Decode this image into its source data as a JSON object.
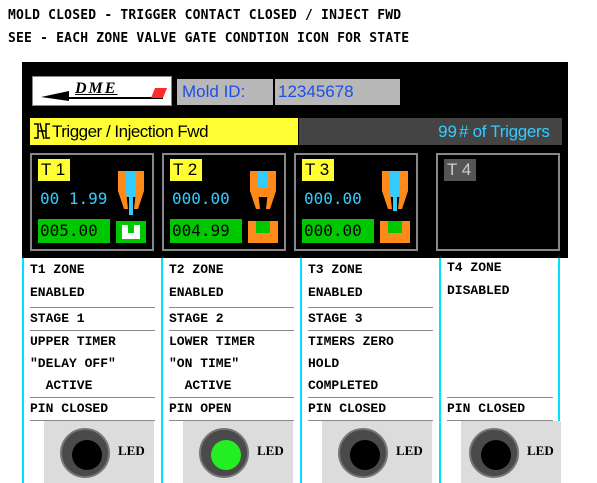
{
  "header": {
    "line1": "MOLD CLOSED - TRIGGER CONTACT CLOSED / INJECT FWD",
    "line2": "SEE - EACH ZONE VALVE GATE CONDTION ICON FOR STATE"
  },
  "logo": {
    "text": "DME"
  },
  "mold": {
    "label": "Mold ID:",
    "value": "12345678"
  },
  "trigger": {
    "label": "Trigger / Injection Fwd",
    "count": "99",
    "count_label": "# of Triggers"
  },
  "colors": {
    "accent_yellow": "#ffff33",
    "accent_cyan": "#33ccff",
    "accent_green": "#00c800",
    "valve_orange": "#ff8a1a",
    "divider_cyan": "#00e0ff",
    "led_on": "#22ee22",
    "led_off": "#000000"
  },
  "tiles": [
    {
      "tag": "T 1",
      "time": "00 1.99",
      "set": "005.00",
      "enabled": true,
      "valve_state": "closed"
    },
    {
      "tag": "T 2",
      "time": "000.00",
      "set": "004.99",
      "enabled": true,
      "valve_state": "open"
    },
    {
      "tag": "T 3",
      "time": "000.00",
      "set": "000.00",
      "enabled": true,
      "valve_state": "closed"
    },
    {
      "tag": "T 4",
      "time": "",
      "set": "",
      "enabled": false,
      "valve_state": "none"
    }
  ],
  "zones": [
    {
      "title": "T1 ZONE",
      "status": "ENABLED",
      "stage": "STAGE 1",
      "timer1": "UPPER TIMER",
      "timer2": "\"DELAY OFF\"",
      "timer3": "  ACTIVE",
      "pin": "PIN CLOSED",
      "led": "off",
      "led_label": "LED"
    },
    {
      "title": "T2 ZONE",
      "status": "ENABLED",
      "stage": "STAGE 2",
      "timer1": "LOWER TIMER",
      "timer2": "\"ON TIME\"",
      "timer3": "  ACTIVE",
      "pin": "PIN OPEN",
      "led": "on",
      "led_label": "LED"
    },
    {
      "title": "T3 ZONE",
      "status": "ENABLED",
      "stage": "STAGE 3",
      "timer1": "TIMERS ZERO",
      "timer2": "HOLD",
      "timer3": "COMPLETED",
      "pin": "PIN CLOSED",
      "led": "off",
      "led_label": "LED"
    },
    {
      "title": "T4 ZONE",
      "status": "DISABLED",
      "stage": "",
      "timer1": "",
      "timer2": "",
      "timer3": "",
      "pin": "PIN CLOSED",
      "led": "off",
      "led_label": "LED"
    }
  ]
}
